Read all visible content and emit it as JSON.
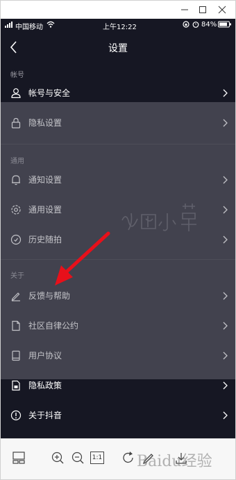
{
  "statusbar": {
    "carrier": "中国移动",
    "time": "上午12:22",
    "battery": "84%"
  },
  "nav": {
    "title": "设置"
  },
  "sections": {
    "account": "帐号",
    "general": "通用",
    "about": "关于"
  },
  "rows": {
    "account_security": "帐号与安全",
    "privacy_settings": "隐私设置",
    "notification_settings": "通知设置",
    "general_settings": "通用设置",
    "history": "历史随拍",
    "feedback": "反馈与帮助",
    "community": "社区自律公约",
    "agreement": "用户协议",
    "privacy_policy": "隐私政策",
    "about_douyin": "关于抖音"
  },
  "toolbar": {
    "fit_label": "1:1"
  },
  "watermark": {
    "site_text": "Baidu经验"
  },
  "colors": {
    "background": "#161723",
    "arrow": "#e8101a",
    "text": "#ffffff",
    "muted": "#9a9aa2"
  },
  "icons": {
    "back": "chevron-left-icon",
    "user": "user-icon",
    "lock": "lock-icon",
    "bell": "bell-icon",
    "gear": "gear-icon",
    "history": "history-icon",
    "edit": "pencil-icon",
    "doc": "document-icon",
    "book": "book-icon",
    "info": "info-icon"
  }
}
